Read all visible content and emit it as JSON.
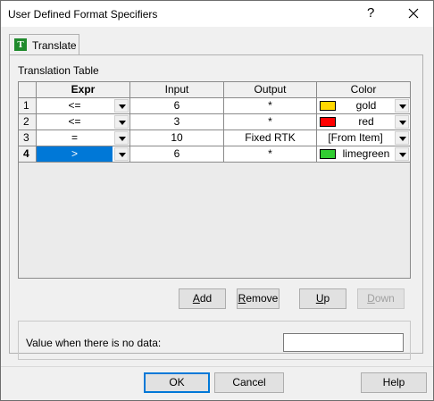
{
  "window": {
    "title": "User Defined Format Specifiers",
    "help_glyph": "?"
  },
  "tab": {
    "icon_letter": "T",
    "label": "Translate"
  },
  "group_label": "Translation Table",
  "table": {
    "columns": [
      "Expr",
      "Input",
      "Output",
      "Color"
    ],
    "rows": [
      {
        "num": "1",
        "expr": "<=",
        "input": "6",
        "output": "*",
        "color": "gold",
        "swatch": "#ffd700"
      },
      {
        "num": "2",
        "expr": "<=",
        "input": "3",
        "output": "*",
        "color": "red",
        "swatch": "#ff0000"
      },
      {
        "num": "3",
        "expr": "=",
        "input": "10",
        "output": "Fixed RTK",
        "color": "[From Item]",
        "swatch": ""
      },
      {
        "num": "4",
        "expr": ">",
        "input": "6",
        "output": "*",
        "color": "limegreen",
        "swatch": "#32cd32"
      }
    ],
    "selected_row": 4
  },
  "buttons": {
    "add": {
      "pre": "",
      "mnemonic": "A",
      "post": "dd"
    },
    "remove": {
      "pre": "",
      "mnemonic": "R",
      "post": "emove"
    },
    "up": {
      "pre": "",
      "mnemonic": "U",
      "post": "p"
    },
    "down": {
      "pre": "",
      "mnemonic": "D",
      "post": "own"
    },
    "ok": "OK",
    "cancel": "Cancel",
    "help": "Help"
  },
  "nodata": {
    "label": "Value when there is no data:",
    "value": ""
  },
  "colors": {
    "selection": "#0078d7",
    "tab_icon": "#1f8a2c"
  }
}
